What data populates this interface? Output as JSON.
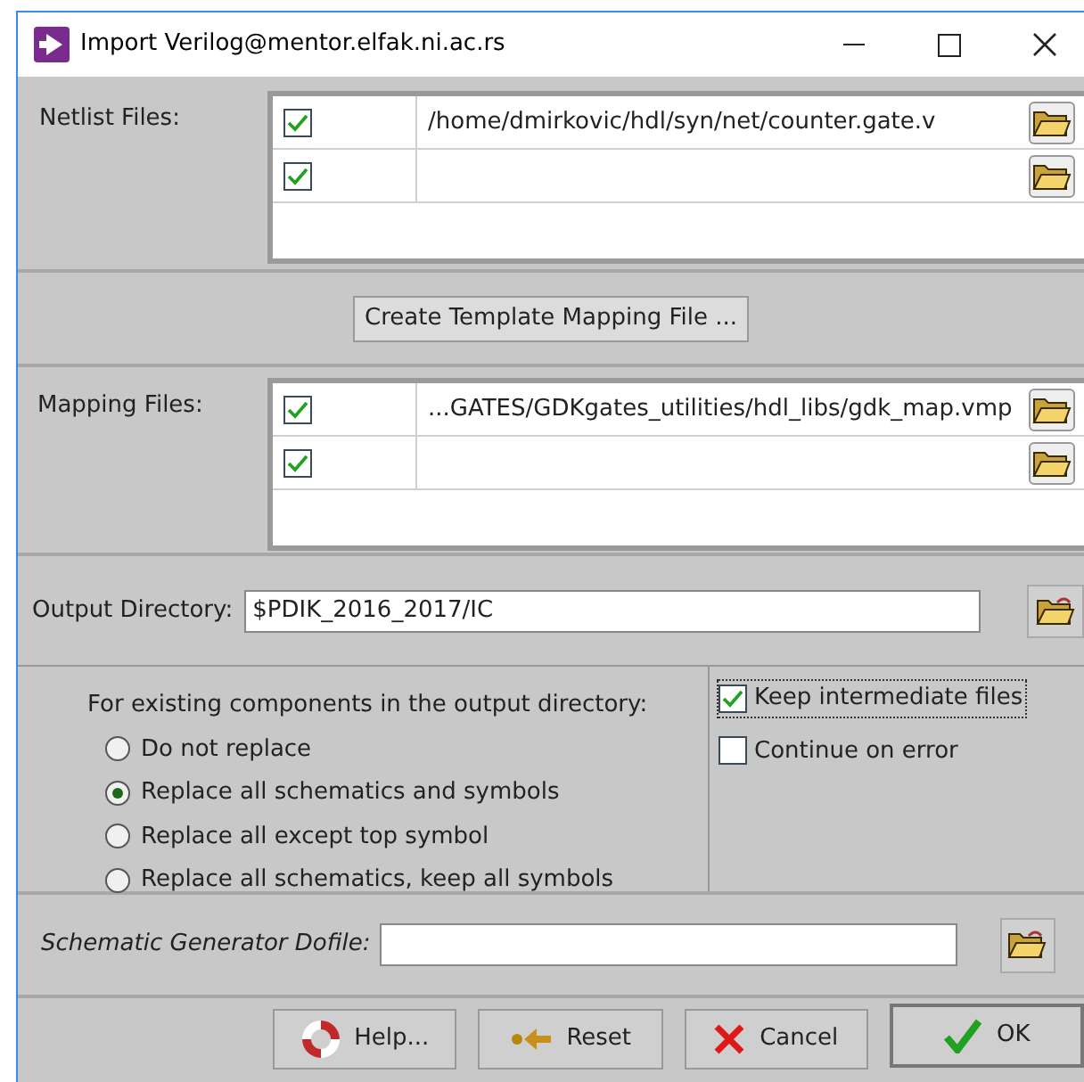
{
  "window": {
    "title": "Import Verilog@mentor.elfak.ni.ac.rs"
  },
  "netlist_files": {
    "label": "Netlist Files:",
    "rows": [
      {
        "checked": true,
        "path": "/home/dmirkovic/hdl/syn/net/counter.gate.v"
      },
      {
        "checked": true
      }
    ]
  },
  "create_template_button": "Create Template Mapping File ...",
  "mapping_files": {
    "label": "Mapping Files:",
    "rows": [
      {
        "checked": true,
        "path": "...GATES/GDKgates_utilities/hdl_libs/gdk_map.vmp"
      },
      {
        "checked": true
      }
    ]
  },
  "output_directory": {
    "label": "Output Directory:",
    "value": "$PDIK_2016_2017/IC"
  },
  "existing_components": {
    "label": "For existing components in the output directory:",
    "options": [
      {
        "label": "Do not replace",
        "selected": false
      },
      {
        "label": "Replace all schematics and symbols",
        "selected": true
      },
      {
        "label": "Replace all except top symbol",
        "selected": false
      },
      {
        "label": "Replace all schematics, keep all symbols",
        "selected": false
      }
    ]
  },
  "options": [
    {
      "label": "Keep intermediate files",
      "checked": true,
      "focused": true
    },
    {
      "label": "Continue on error",
      "checked": false,
      "focused": false
    }
  ],
  "dofile": {
    "label": "Schematic Generator Dofile:"
  },
  "buttons": [
    {
      "label": "Help...",
      "kind": "help",
      "default": false
    },
    {
      "label": "Reset",
      "kind": "reset",
      "default": false
    },
    {
      "label": "Cancel",
      "kind": "cancel",
      "default": false
    },
    {
      "label": "OK",
      "kind": "ok",
      "default": true
    }
  ]
}
